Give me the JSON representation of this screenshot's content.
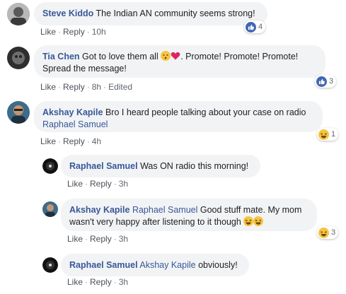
{
  "comments": [
    {
      "name": "Steve Kiddo",
      "text": "The Indian AN community seems strong!",
      "actions": {
        "like": "Like",
        "reply": "Reply",
        "time": "10h"
      },
      "reaction_count": "4",
      "reaction_icon": "like-icon"
    },
    {
      "name": "Tia Chen",
      "text_before": "Got to love them all",
      "text_after": ". Promote! Promote! Promote! Spread the message!",
      "actions": {
        "like": "Like",
        "reply": "Reply",
        "time": "8h",
        "edited": "Edited"
      },
      "reaction_count": "3",
      "reaction_icon": "like-icon"
    },
    {
      "name": "Akshay Kapile",
      "text": "Bro I heard people talking about your case on radio",
      "mention": "Raphael Samuel",
      "actions": {
        "like": "Like",
        "reply": "Reply",
        "time": "4h"
      },
      "reaction_count": "1",
      "reaction_icon": "haha-icon"
    }
  ],
  "replies": [
    {
      "name": "Raphael Samuel",
      "text": "Was ON radio this morning!",
      "actions": {
        "like": "Like",
        "reply": "Reply",
        "time": "3h"
      }
    },
    {
      "name": "Akshay Kapile",
      "mention": "Raphael Samuel",
      "text": "Good stuff mate. My mom wasn't very happy after listening to it though",
      "actions": {
        "like": "Like",
        "reply": "Reply",
        "time": "3h"
      },
      "reaction_count": "3",
      "reaction_icon": "haha-icon"
    },
    {
      "name": "Raphael Samuel",
      "mention": "Akshay Kapile",
      "text": "obviously!",
      "actions": {
        "like": "Like",
        "reply": "Reply",
        "time": "3h"
      }
    }
  ],
  "colors": {
    "name_link": "#385898",
    "bubble_bg": "#f2f3f5",
    "like_blue": "#4267b2",
    "haha_yellow": "#f7c442"
  }
}
